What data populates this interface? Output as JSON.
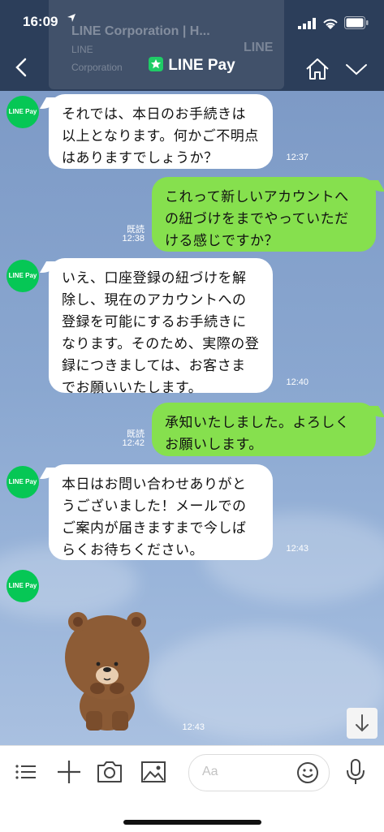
{
  "status": {
    "time": "16:09"
  },
  "ghost": {
    "line1": "LINE Corporation | H...",
    "line2": "LINE",
    "line3": "LINE",
    "line4": "Corporation"
  },
  "header": {
    "title": "LINE Pay"
  },
  "avatar_label": "LINE Pay",
  "messages": [
    {
      "text": "それでは、本日のお手続きは以上となります。何かご不明点はありますでしょうか？",
      "time": "12:37"
    },
    {
      "text": "これって新しいアカウントへの紐づけをまでやっていただける感じですか？",
      "read": "既読",
      "time": "12:38"
    },
    {
      "text": "いえ、口座登録の紐づけを解除し、現在のアカウントへの登録を可能にするお手続きになります。そのため、実際の登録につきましては、お客さまでお願いいたします。",
      "time": "12:40"
    },
    {
      "text": "承知いたしました。よろしくお願いします。",
      "read": "既読",
      "time": "12:42"
    },
    {
      "text": "本日はお問い合わせありがとうございました！メールでのご案内が届きますまで今しばらくお待ちください。",
      "time": "12:43"
    },
    {
      "time": "12:43"
    }
  ],
  "input": {
    "placeholder": "Aa"
  },
  "colors": {
    "header": "#2c3e5a",
    "line_green": "#06c755",
    "outgoing": "#86e04e",
    "chat_bg": "#8aa7d0"
  }
}
